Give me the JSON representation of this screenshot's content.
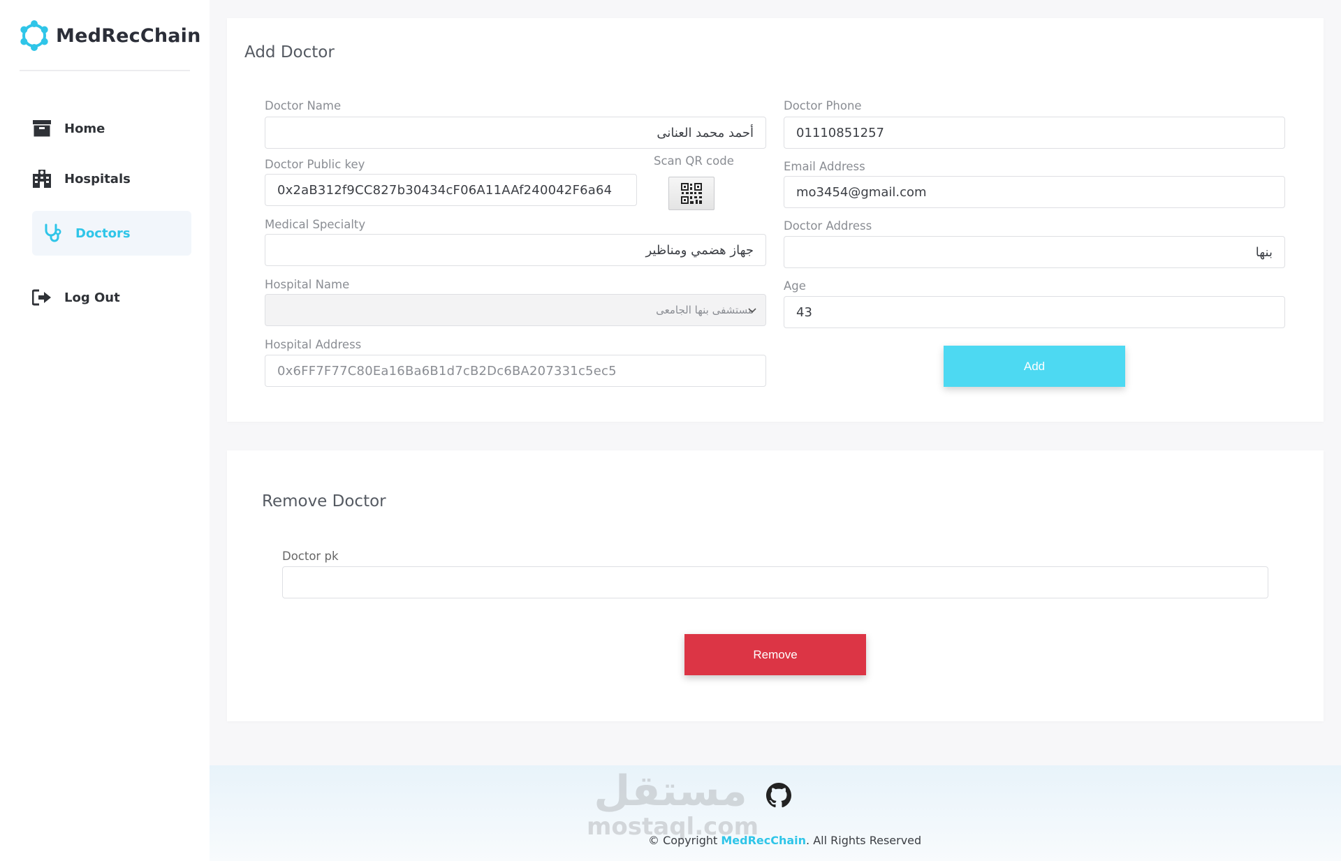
{
  "brand": {
    "name": "MedRecChain",
    "accent": "#2fc5e8"
  },
  "sidebar": {
    "items": [
      {
        "label": "Home",
        "icon": "archive-box-icon"
      },
      {
        "label": "Hospitals",
        "icon": "hospital-building-icon"
      },
      {
        "label": "Doctors",
        "icon": "stethoscope-icon",
        "active": true
      },
      {
        "label": "Log Out",
        "icon": "sign-out-icon"
      }
    ]
  },
  "add_doctor": {
    "title": "Add Doctor",
    "doctor_name": {
      "label": "Doctor Name",
      "value": "أحمد محمد العنانى"
    },
    "doctor_public_key": {
      "label": "Doctor Public key",
      "value": "0x2aB312f9CC827b30434cF06A11AAf240042F6a64"
    },
    "scan_qr": {
      "label": "Scan QR code",
      "icon": "qr-code-icon"
    },
    "medical_specialty": {
      "label": "Medical Specialty",
      "value": "جهاز هضمي ومناظير"
    },
    "hospital_name": {
      "label": "Hospital Name",
      "value": "مستشفى بنها الجامعى"
    },
    "hospital_address": {
      "label": "Hospital Address",
      "value": "0x6FF7F77C80Ea16Ba6B1d7cB2Dc6BA207331c5ec5"
    },
    "doctor_phone": {
      "label": "Doctor Phone",
      "value": "01110851257"
    },
    "email_address": {
      "label": "Email Address",
      "value": "mo3454@gmail.com"
    },
    "doctor_address": {
      "label": "Doctor Address",
      "value": "بنها"
    },
    "age": {
      "label": "Age",
      "value": "43"
    },
    "add_label": "Add",
    "add_color": "#4dd9f2"
  },
  "remove_doctor": {
    "title": "Remove Doctor",
    "doctor_pk": {
      "label": "Doctor pk",
      "value": ""
    },
    "remove_label": "Remove",
    "remove_color": "#dc3545"
  },
  "footer": {
    "watermark_ar": "مستقل",
    "watermark_en": "mostaql.com",
    "copyright_prefix": "© Copyright",
    "copyright_brand": "MedRecChain",
    "copyright_suffix": ". All Rights Reserved",
    "github_icon": "github-icon"
  }
}
